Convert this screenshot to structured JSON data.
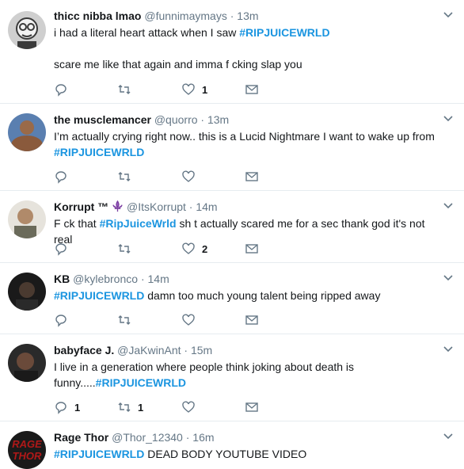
{
  "tweets": [
    {
      "name": "thicc nibba lmao",
      "handle": "@funnimaymays",
      "separator": "·",
      "time": "13m",
      "text_parts": [
        {
          "t": "i had a literal heart attack when I saw "
        },
        {
          "t": "#RIPJUICEWRLD",
          "tag": true
        },
        {
          "t": "\n\nscare me like that again and imma f  cking slap you"
        }
      ],
      "replies": "",
      "retweets": "",
      "likes": "1",
      "avatar_colors": [
        "#cfcfcf",
        "#3a3a3a"
      ]
    },
    {
      "name": "the musclemancer",
      "handle": "@quorro",
      "separator": "·",
      "time": "13m",
      "text_parts": [
        {
          "t": "I’m actually crying right now.. this is a Lucid Nightmare I want to wake up from\n"
        },
        {
          "t": "#RIPJUICEWRLD",
          "tag": true
        }
      ],
      "replies": "",
      "retweets": "",
      "likes": "",
      "avatar_colors": [
        "#5a7fb0",
        "#8a5a3c"
      ]
    },
    {
      "name": "Korrupt ™",
      "handle": "@ItsKorrupt",
      "separator": "·",
      "time": "14m",
      "text_parts": [
        {
          "t": "F  ck that "
        },
        {
          "t": "#RipJuiceWrld",
          "tag": true
        },
        {
          "t": " sh  t actually scared me for a sec thank god it's not real"
        }
      ],
      "replies": "",
      "retweets": "",
      "likes": "2",
      "avatar_colors": [
        "#b08a6a",
        "#e6e3dc"
      ]
    },
    {
      "name": "KB",
      "handle": "@kylebronco",
      "separator": "·",
      "time": "14m",
      "text_parts": [
        {
          "t": "#RIPJUICEWRLD",
          "tag": true
        },
        {
          "t": " damn too much young talent being ripped away"
        }
      ],
      "replies": "",
      "retweets": "",
      "likes": "",
      "avatar_colors": [
        "#1a1a1a",
        "#4a3a30"
      ]
    },
    {
      "name": "babyface J.",
      "handle": "@JaKwinAnt",
      "separator": "·",
      "time": "15m",
      "text_parts": [
        {
          "t": "I live in a generation where people think joking about death is\nfunny....."
        },
        {
          "t": "#RIPJUICEWRLD",
          "tag": true
        }
      ],
      "replies": "1",
      "retweets": "1",
      "likes": "",
      "avatar_colors": [
        "#2a2a2a",
        "#6a4a3a"
      ]
    },
    {
      "name": "Rage Thor",
      "handle": "@Thor_12340",
      "separator": "·",
      "time": "16m",
      "text_parts": [
        {
          "t": "#RIPJUICEWRLD",
          "tag": true
        },
        {
          "t": " DEAD BODY YOUTUBE VIDEO"
        }
      ],
      "replies": "",
      "retweets": "",
      "likes": "",
      "avatar_colors": [
        "#b01818",
        "#1a1a1a"
      ],
      "avatar_text": [
        "RAGE",
        "THOR"
      ]
    }
  ],
  "colors": {
    "accent": "#1b95e0",
    "muted": "#657786",
    "border": "#e6ecf0"
  }
}
